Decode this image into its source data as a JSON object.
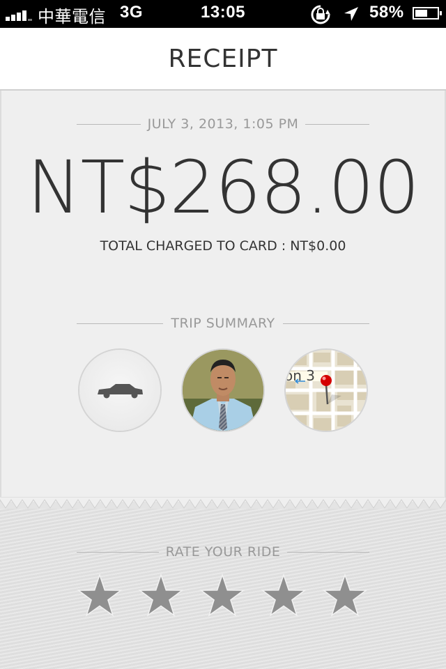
{
  "status_bar": {
    "carrier": "中華電信",
    "network": "3G",
    "time": "13:05",
    "battery": "58%",
    "battery_level": 0.58,
    "icons": [
      "signal-icon",
      "rotation-lock-icon",
      "location-arrow-icon",
      "battery-icon"
    ]
  },
  "header": {
    "title": "RECEIPT"
  },
  "receipt": {
    "datetime": "JULY 3, 2013, 1:05 PM",
    "amount": "NT$268.00",
    "charged_line": "TOTAL CHARGED TO CARD : NT$0.00"
  },
  "trip_summary": {
    "label": "TRIP SUMMARY",
    "items": [
      "car-icon",
      "driver-photo",
      "map-thumbnail"
    ],
    "map_text": "on 3"
  },
  "rating": {
    "label": "RATE YOUR RIDE",
    "stars_total": 5,
    "stars_selected": 0
  },
  "colors": {
    "text_dark": "#333333",
    "text_muted": "#999999",
    "star": "#8f8f8f",
    "pin": "#d40000"
  }
}
